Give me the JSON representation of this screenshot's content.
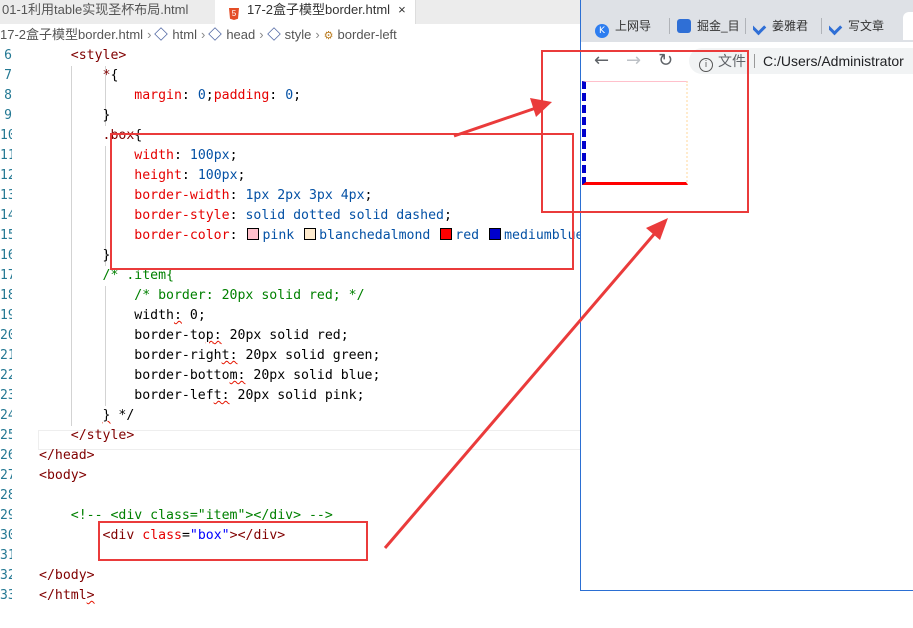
{
  "editor_tabs": {
    "inactive": "01-1利用table实现圣杯布局.html",
    "active": "17-2盒子模型border.html",
    "close": "×",
    "html5_badge": "5"
  },
  "breadcrumb": [
    "17-2盒子模型border.html",
    "html",
    "head",
    "style",
    "border-left"
  ],
  "code_lines": [
    {
      "n": "6",
      "html": "    <span class=\"br\">&lt;</span><span class=\"tag\">style</span><span class=\"br\">&gt;</span>"
    },
    {
      "n": "7",
      "html": "        <span class=\"tag\">*</span><span class=\"plain\">{</span>"
    },
    {
      "n": "8",
      "html": "            <span class=\"prop\">margin</span><span class=\"plain\">: </span><span class=\"val\">0</span><span class=\"plain\">;</span><span class=\"prop\">padding</span><span class=\"plain\">: </span><span class=\"val\">0</span><span class=\"plain\">;</span>"
    },
    {
      "n": "9",
      "html": "        <span class=\"plain\">}</span>"
    },
    {
      "n": "10",
      "html": "        <span class=\"tag\">.box</span><span class=\"plain\">{</span>"
    },
    {
      "n": "11",
      "html": "            <span class=\"prop\">width</span><span class=\"plain\">: </span><span class=\"val\">100px</span><span class=\"plain\">;</span>"
    },
    {
      "n": "12",
      "html": "            <span class=\"prop\">height</span><span class=\"plain\">: </span><span class=\"val\">100px</span><span class=\"plain\">;</span>"
    },
    {
      "n": "13",
      "html": "            <span class=\"prop\">border-width</span><span class=\"plain\">: </span><span class=\"val\">1px 2px 3px 4px</span><span class=\"plain\">;</span>"
    },
    {
      "n": "14",
      "html": "            <span class=\"prop\">border-style</span><span class=\"plain\">: </span><span class=\"val\">solid dotted solid dashed</span><span class=\"plain\">;</span>"
    },
    {
      "n": "15",
      "html": "            <span class=\"prop\">border-color</span><span class=\"plain\">: </span><span class=\"sq\" style=\"background:#ffc0cb\"></span><span class=\"val\">pink</span> <span class=\"sq\" style=\"background:#ffebcd\"></span><span class=\"val\">blanchedalmond</span> <span class=\"sq\" style=\"background:#ff0000\"></span><span class=\"val\">red</span> <span class=\"sq\" style=\"background:#0000cd\"></span><span class=\"val\">mediumblue</span><span class=\"plain\">;</span>"
    },
    {
      "n": "16",
      "html": "        <span class=\"plain\">}</span>"
    },
    {
      "n": "17",
      "html": "        <span class=\"cmt\">/* .item{</span>"
    },
    {
      "n": "18",
      "html": "            <span class=\"cmt\">/* border: 20px solid red; */</span>"
    },
    {
      "n": "19",
      "html": "            <span class=\"plain\">width<span class=\"squig\">:</span> 0;</span>"
    },
    {
      "n": "20",
      "html": "            <span class=\"plain\">border-to<span class=\"squig\">p:</span> 20px solid red;</span>"
    },
    {
      "n": "21",
      "html": "            <span class=\"plain\">border-righ<span class=\"squig\">t:</span> 20px solid green;</span>"
    },
    {
      "n": "22",
      "html": "            <span class=\"plain\">border-botto<span class=\"squig\">m:</span> 20px solid blue;</span>"
    },
    {
      "n": "23",
      "html": "            <span class=\"plain\">border-lef<span class=\"squig\">t:</span> 20px solid pink;</span>"
    },
    {
      "n": "24",
      "html": "        <span class=\"plain\"><span class=\"squig\">}</span> */</span>"
    },
    {
      "n": "25",
      "html": "    <span class=\"br\">&lt;/</span><span class=\"tag\">style</span><span class=\"br\">&gt;</span>"
    },
    {
      "n": "26",
      "html": "<span class=\"br\">&lt;/</span><span class=\"tag\">head</span><span class=\"br\">&gt;</span>"
    },
    {
      "n": "27",
      "html": "<span class=\"br\">&lt;</span><span class=\"tag\">body</span><span class=\"br\">&gt;</span>"
    },
    {
      "n": "28",
      "html": ""
    },
    {
      "n": "29",
      "html": "    <span class=\"cmt\">&lt;!-- &lt;div class=\"item\"&gt;&lt;/div&gt; --&gt;</span>"
    },
    {
      "n": "30",
      "html": "        <span class=\"br\">&lt;</span><span class=\"tag\">div</span> <span class=\"attr\">class</span><span class=\"plain\">=</span><span class=\"str\">\"box\"</span><span class=\"br\">&gt;&lt;/</span><span class=\"tag\">div</span><span class=\"br\">&gt;</span>"
    },
    {
      "n": "31",
      "html": ""
    },
    {
      "n": "32",
      "html": "<span class=\"br\">&lt;/</span><span class=\"tag\">body</span><span class=\"br\">&gt;</span>"
    },
    {
      "n": "33",
      "html": "<span class=\"br\">&lt;/</span><span class=\"tag\">html</span><span class=\"br\"><span class=\"squig\">&gt;</span></span>"
    }
  ],
  "browser": {
    "tabs": [
      {
        "label": "上网导",
        "icon": "k-logo-icon",
        "color": "#2d7df0"
      },
      {
        "label": "掘金_目",
        "icon": "paw-icon",
        "color": "#2f6fd6"
      },
      {
        "label": "姜雅君",
        "icon": "layers-icon",
        "color": "#2f6fd6"
      },
      {
        "label": "写文章",
        "icon": "layers-icon",
        "color": "#2f6fd6"
      }
    ],
    "back": "←",
    "forward": "→",
    "reload": "↻",
    "info": "i",
    "scheme_label": "文件",
    "address": "C:/Users/Administrator"
  },
  "colors": {
    "annotation": "#ea3b3b",
    "box_border_top": "#ffc0cb",
    "box_border_right": "#ffebcd",
    "box_border_bottom": "#ff0000",
    "box_border_left": "#0000cd"
  }
}
